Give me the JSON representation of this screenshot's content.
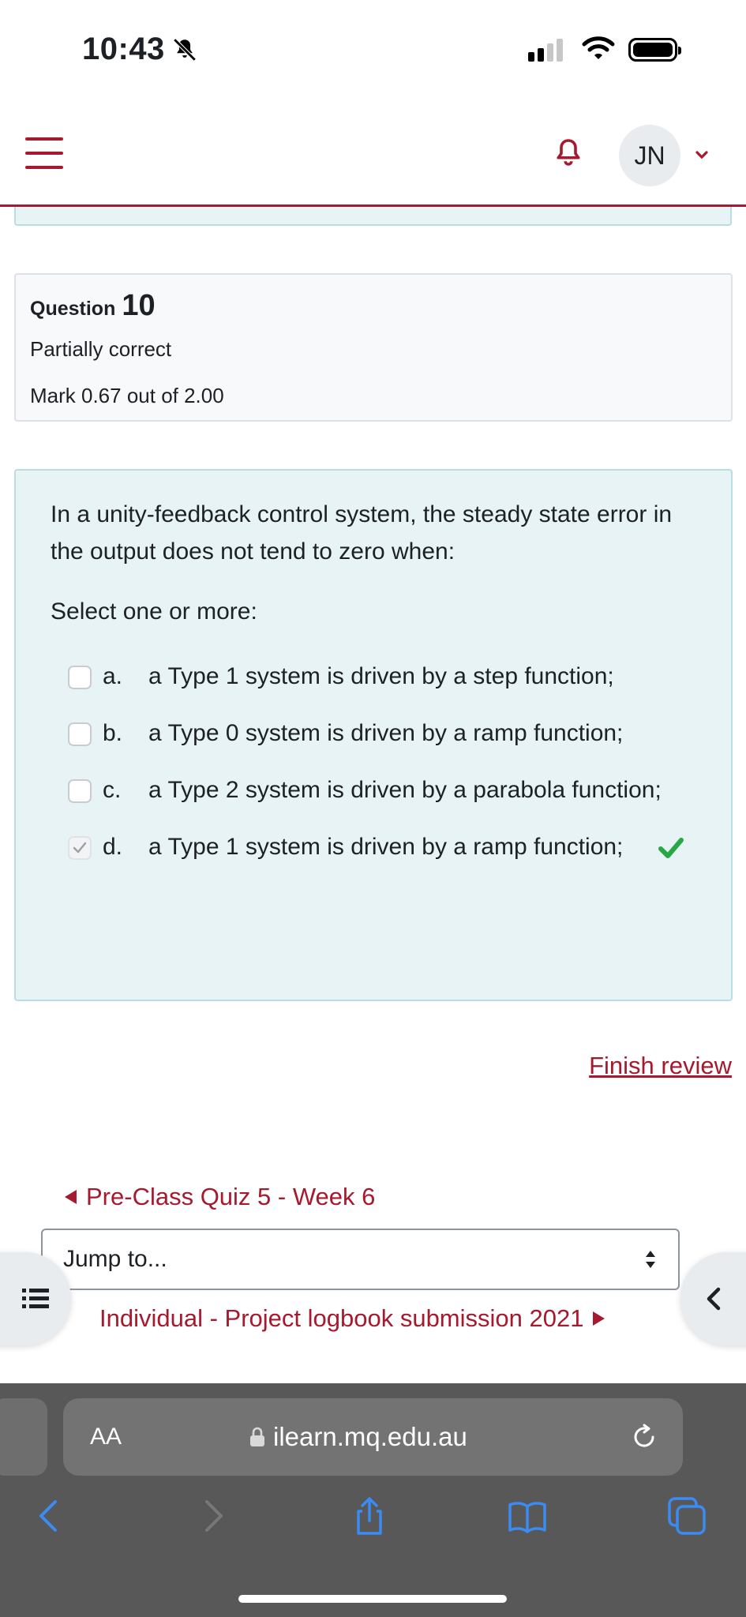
{
  "status_bar": {
    "time": "10:43"
  },
  "header": {
    "user_initials": "JN"
  },
  "question_info": {
    "label": "Question",
    "number": "10",
    "state": "Partially correct",
    "grade": "Mark 0.67 out of 2.00"
  },
  "question": {
    "text": "In a unity-feedback control system, the steady state error in the output does not tend to zero when:",
    "prompt": "Select one or more:",
    "answers": [
      {
        "letter": "a.",
        "text": "a Type 1 system is driven by a step function;",
        "checked": false,
        "correct": false
      },
      {
        "letter": "b.",
        "text": "a Type 0 system is driven by a ramp function;",
        "checked": false,
        "correct": false
      },
      {
        "letter": "c.",
        "text": "a Type 2 system is driven by a parabola function;",
        "checked": false,
        "correct": false
      },
      {
        "letter": "d.",
        "text": "a Type 1 system is driven by a ramp function;",
        "checked": true,
        "correct": true
      }
    ]
  },
  "navigation": {
    "finish_review": "Finish review",
    "prev_activity": "Pre-Class Quiz 5 - Week 6",
    "jump_to": "Jump to...",
    "next_activity": "Individual - Project logbook submission 2021"
  },
  "browser": {
    "text_size_label": "AA",
    "url": "ilearn.mq.edu.au"
  },
  "colors": {
    "brand": "#a6192e",
    "content_bg": "#e7f3f5",
    "correct_green": "#28a745",
    "safari_bar": "#585858"
  }
}
